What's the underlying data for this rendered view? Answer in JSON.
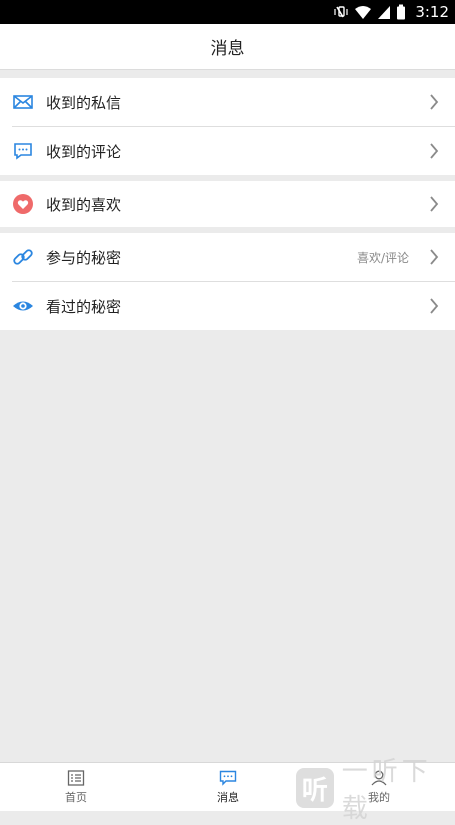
{
  "status": {
    "time": "3:12"
  },
  "header": {
    "title": "消息"
  },
  "groups": {
    "messages": [
      {
        "label": "收到的私信"
      },
      {
        "label": "收到的评论"
      }
    ],
    "likes": [
      {
        "label": "收到的喜欢"
      }
    ],
    "secrets": [
      {
        "label": "参与的秘密",
        "hint": "喜欢/评论"
      },
      {
        "label": "看过的秘密"
      }
    ]
  },
  "tabs": [
    {
      "label": "首页",
      "icon": "list-icon"
    },
    {
      "label": "消息",
      "icon": "chat-icon",
      "active": true
    },
    {
      "label": "我的",
      "icon": "person-icon"
    }
  ],
  "watermark": {
    "badge": "听",
    "text": "一听下载"
  },
  "colors": {
    "accent": "#2b86e0",
    "heart": "#ef6a6a",
    "background": "#ebebeb"
  }
}
